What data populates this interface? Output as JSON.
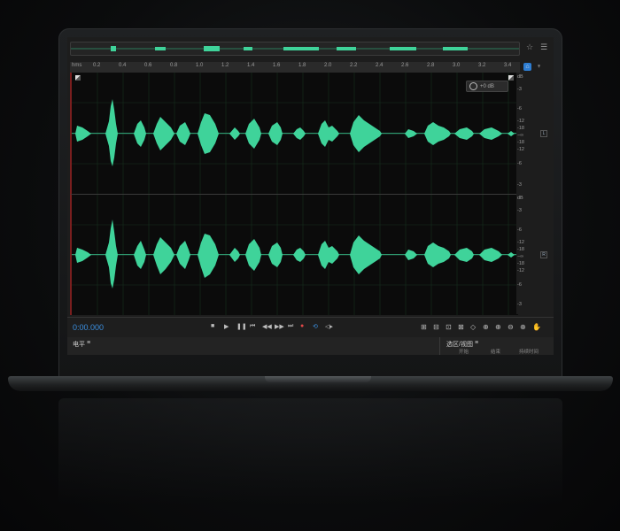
{
  "editor": {
    "ruler_labels": [
      "hms",
      "0.2",
      "0.4",
      "0.6",
      "0.8",
      "1.0",
      "1.2",
      "1.4",
      "1.6",
      "1.8",
      "2.0",
      "2.2",
      "2.4",
      "2.6",
      "2.8",
      "3.0",
      "3.2",
      "3.4"
    ],
    "db_labels_track1": [
      "dB",
      "-3",
      "-6",
      "-12",
      "-18",
      "−∞",
      "-18",
      "-12",
      "-6",
      "-3"
    ],
    "db_labels_track2": [
      "dB",
      "-3",
      "-6",
      "-12",
      "-18",
      "−∞",
      "-18",
      "-12",
      "-6",
      "-3"
    ],
    "channel_left": "L",
    "channel_right": "R",
    "level_value": "+0 dB",
    "timecode": "0:00.000",
    "panel_left_title": "电平",
    "panel_right_title": "选区/视图",
    "panel_right_columns": [
      "开始",
      "结束",
      "持续时间"
    ],
    "waveform_color": "#3fd39a",
    "accent_color": "#2d7dd2",
    "record_color": "#e24848"
  },
  "icons": {
    "top": [
      "star-icon",
      "menu-icon"
    ],
    "transport": [
      "stop-icon",
      "play-icon",
      "pause-icon",
      "skip-back-icon",
      "rewind-icon",
      "fast-forward-icon",
      "skip-forward-icon",
      "record-icon",
      "loop-icon",
      "output-icon"
    ],
    "zoom": [
      "zoom-in-amplitude-icon",
      "zoom-out-amplitude-icon",
      "zoom-in-time-icon",
      "zoom-out-time-icon",
      "zoom-to-selection-icon",
      "zoom-in-left-icon",
      "zoom-in-right-icon",
      "zoom-out-full-icon",
      "zoom-in-icon",
      "zoom-out-icon",
      "hand-icon"
    ]
  }
}
